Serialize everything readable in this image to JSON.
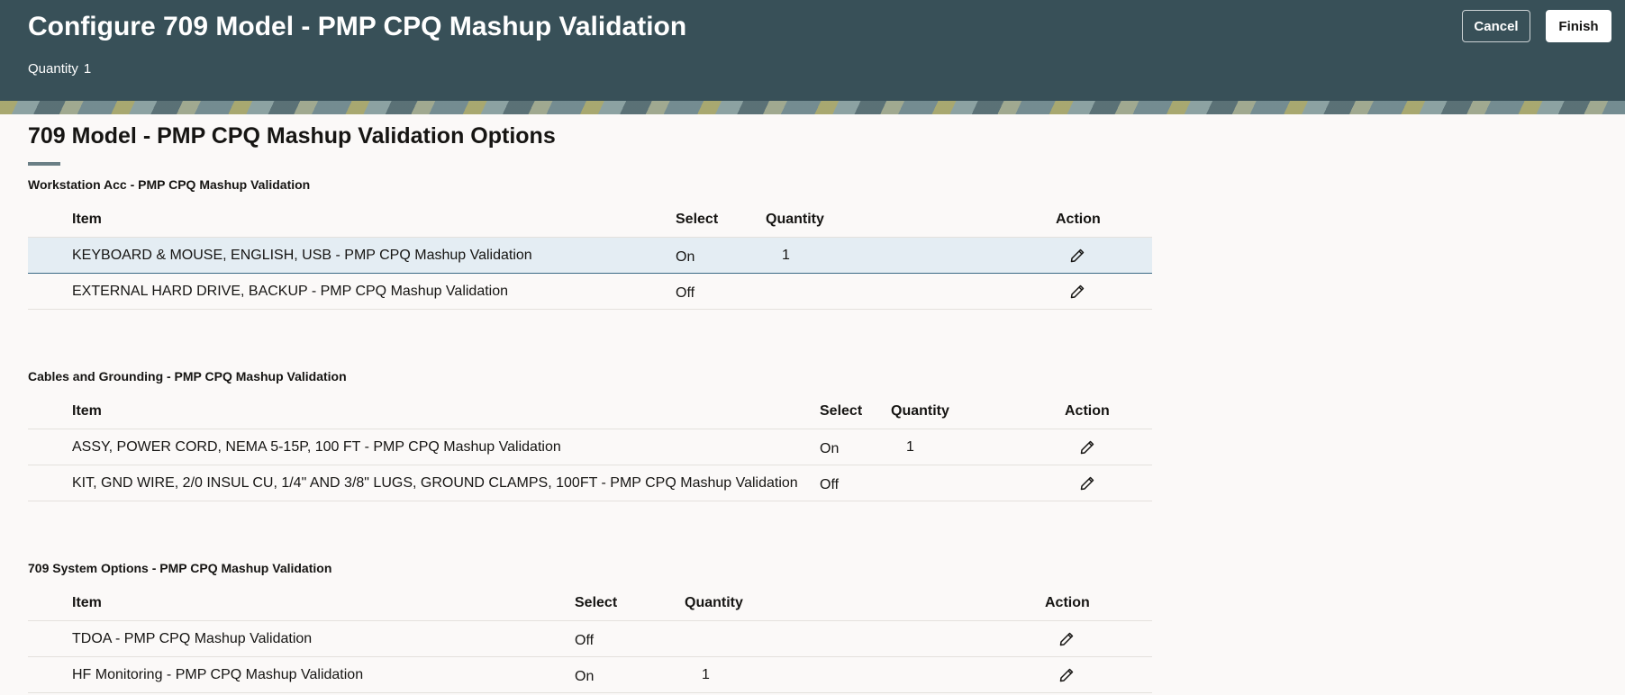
{
  "header": {
    "title": "Configure 709 Model - PMP CPQ Mashup Validation",
    "quantity_label": "Quantity",
    "quantity_value": "1",
    "cancel_label": "Cancel",
    "finish_label": "Finish"
  },
  "main": {
    "heading": "709 Model - PMP CPQ Mashup Validation Options"
  },
  "icons": {
    "edit": "pencil-icon"
  },
  "colors": {
    "header_bg": "#385058",
    "selected_row_bg": "#e4edf3"
  },
  "sections": [
    {
      "title": "Workstation Acc - PMP CPQ Mashup Validation",
      "columns": {
        "item": "Item",
        "select": "Select",
        "quantity": "Quantity",
        "action": "Action"
      },
      "rows": [
        {
          "item": "KEYBOARD & MOUSE, ENGLISH, USB - PMP CPQ Mashup Validation",
          "select": "On",
          "quantity": "1",
          "selected": true
        },
        {
          "item": "EXTERNAL HARD DRIVE, BACKUP - PMP CPQ Mashup Validation",
          "select": "Off",
          "quantity": "",
          "selected": false
        }
      ]
    },
    {
      "title": "Cables and Grounding - PMP CPQ Mashup Validation",
      "columns": {
        "item": "Item",
        "select": "Select",
        "quantity": "Quantity",
        "action": "Action"
      },
      "rows": [
        {
          "item": "ASSY, POWER CORD, NEMA 5-15P, 100 FT - PMP CPQ Mashup Validation",
          "select": "On",
          "quantity": "1",
          "selected": false
        },
        {
          "item": "KIT, GND WIRE, 2/0 INSUL CU, 1/4\" AND 3/8\" LUGS, GROUND CLAMPS, 100FT - PMP CPQ Mashup Validation",
          "select": "Off",
          "quantity": "",
          "selected": false
        }
      ]
    },
    {
      "title": "709 System Options - PMP CPQ Mashup Validation",
      "columns": {
        "item": "Item",
        "select": "Select",
        "quantity": "Quantity",
        "action": "Action"
      },
      "rows": [
        {
          "item": "TDOA - PMP CPQ Mashup Validation",
          "select": "Off",
          "quantity": "",
          "selected": false
        },
        {
          "item": "HF Monitoring - PMP CPQ Mashup Validation",
          "select": "On",
          "quantity": "1",
          "selected": false
        }
      ]
    }
  ]
}
